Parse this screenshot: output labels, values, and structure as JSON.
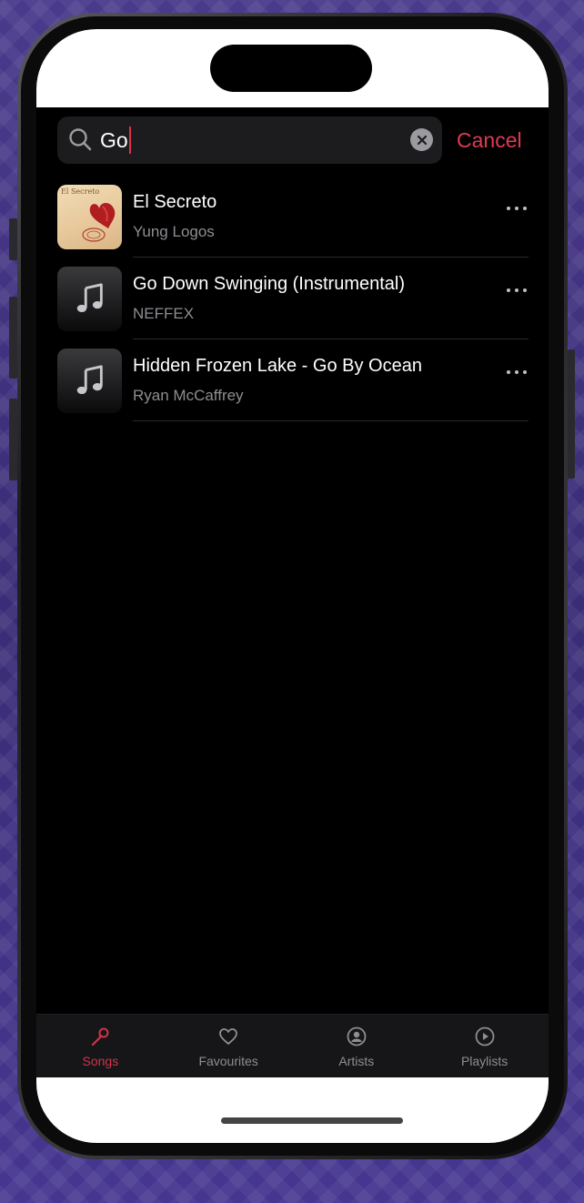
{
  "search": {
    "value": "Go",
    "cancel_label": "Cancel"
  },
  "results": [
    {
      "title": "El Secreto",
      "artist": "Yung Logos",
      "artwork": "album-photo",
      "art_caption": "El Secreto"
    },
    {
      "title": "Go Down Swinging (Instrumental)",
      "artist": "NEFFEX",
      "artwork": "music-note-icon"
    },
    {
      "title": "Hidden Frozen Lake - Go By Ocean",
      "artist": "Ryan McCaffrey",
      "artwork": "music-note-icon"
    }
  ],
  "tabs": [
    {
      "label": "Songs",
      "icon": "microphone-icon",
      "active": true
    },
    {
      "label": "Favourites",
      "icon": "heart-icon",
      "active": false
    },
    {
      "label": "Artists",
      "icon": "person-circle-icon",
      "active": false
    },
    {
      "label": "Playlists",
      "icon": "play-circle-icon",
      "active": false
    }
  ],
  "colors": {
    "accent": "#e13a51",
    "background": "#000000",
    "tabbar": "#161618",
    "secondary_text": "#8e8e93"
  }
}
